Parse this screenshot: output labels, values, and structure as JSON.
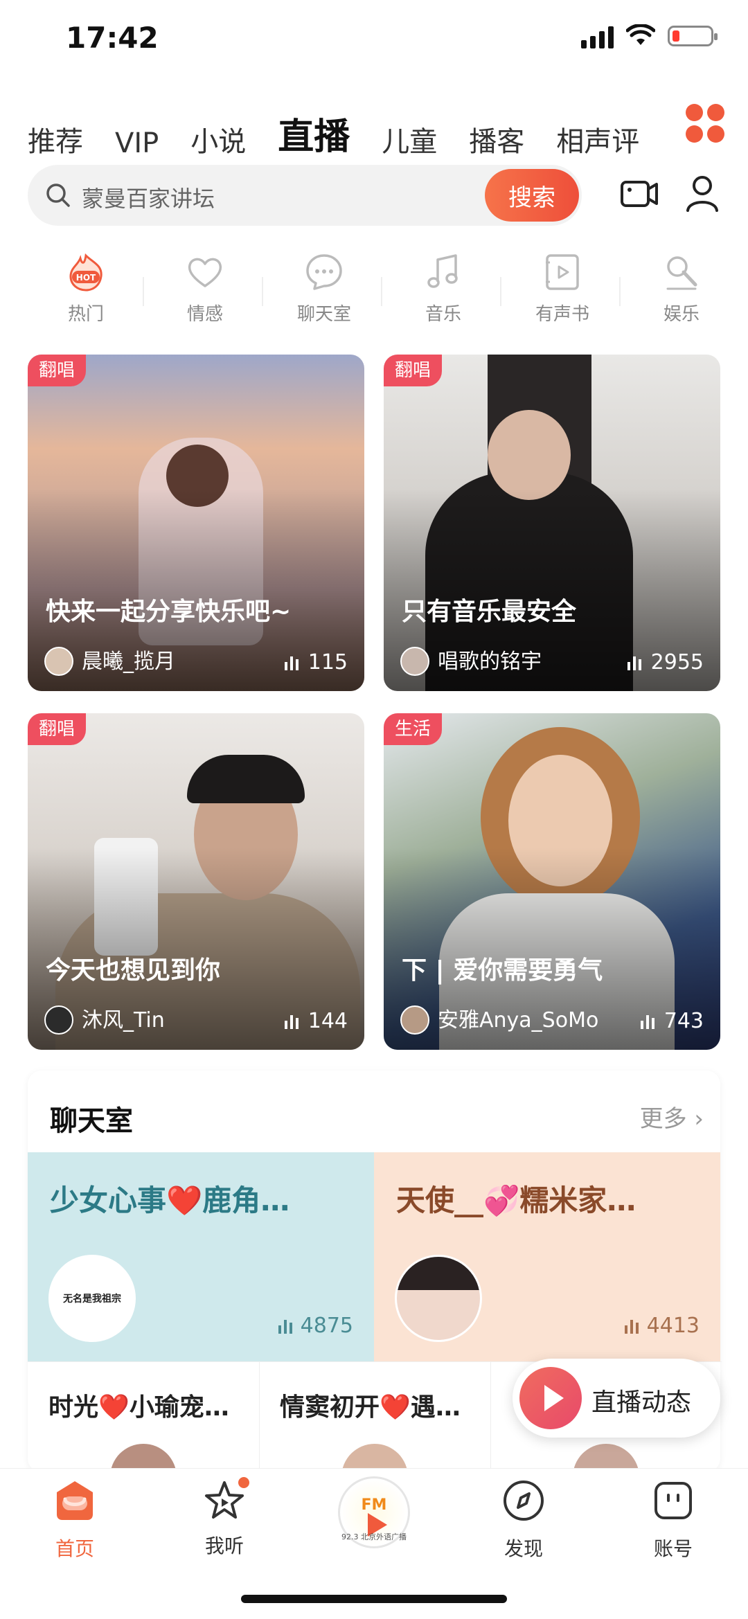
{
  "status_bar": {
    "time": "17:42"
  },
  "top_nav": {
    "tabs": [
      {
        "label": "推荐",
        "active": false
      },
      {
        "label": "VIP",
        "active": false
      },
      {
        "label": "小说",
        "active": false
      },
      {
        "label": "直播",
        "active": true
      },
      {
        "label": "儿童",
        "active": false
      },
      {
        "label": "播客",
        "active": false
      },
      {
        "label": "相声评",
        "active": false
      }
    ],
    "grid_icon": "all-channels-grid-icon"
  },
  "search": {
    "placeholder": "蒙曼百家讲坛",
    "button": "搜索",
    "camera_icon": "live-camera-icon",
    "user_icon": "user-profile-icon"
  },
  "categories": [
    {
      "label": "热门",
      "icon": "hot-icon",
      "active": true
    },
    {
      "label": "情感",
      "icon": "heart-icon",
      "active": false
    },
    {
      "label": "聊天室",
      "icon": "chat-bubble-icon",
      "active": false
    },
    {
      "label": "音乐",
      "icon": "music-note-icon",
      "active": false
    },
    {
      "label": "有声书",
      "icon": "audiobook-icon",
      "active": false
    },
    {
      "label": "娱乐",
      "icon": "microphone-icon",
      "active": false
    }
  ],
  "live_cards": [
    {
      "tag": "翻唱",
      "title": "快来一起分享快乐吧~",
      "anchor": "晨曦_揽月",
      "count": "115"
    },
    {
      "tag": "翻唱",
      "title": "只有音乐最安全",
      "anchor": "唱歌的铭宇",
      "count": "2955"
    },
    {
      "tag": "翻唱",
      "title": "今天也想见到你",
      "anchor": "沐风_Tin",
      "count": "144"
    },
    {
      "tag": "生活",
      "title": "下 | 爱你需要勇气",
      "anchor": "安雅Anya_SoMo",
      "count": "743"
    }
  ],
  "chat_section": {
    "title": "聊天室",
    "more": "更多",
    "featured": [
      {
        "title": "少女心事❤️鹿角…",
        "avatar_text": "无名是我祖宗",
        "count": "4875"
      },
      {
        "title": "天使__💞糯米家…",
        "count": "4413"
      }
    ],
    "rooms": [
      {
        "title": "时光❤️小瑜宠…"
      },
      {
        "title": "情窦初开❤️遇…"
      }
    ]
  },
  "float_button": {
    "label": "直播动态"
  },
  "bottom_tabs": [
    {
      "label": "首页",
      "icon": "home-icon",
      "active": true
    },
    {
      "label": "我听",
      "icon": "listen-star-icon",
      "active": false
    },
    {
      "fm_text": "FM",
      "fm_sub": "92.3 北京外语广播"
    },
    {
      "label": "发现",
      "icon": "discover-compass-icon",
      "active": false
    },
    {
      "label": "账号",
      "icon": "account-icon",
      "active": false
    }
  ],
  "colors": {
    "accent": "#f0663e",
    "tag": "#ee4f5f",
    "chat_teal_bg": "#cfe9ec",
    "chat_peach_bg": "#fbe3d3"
  }
}
